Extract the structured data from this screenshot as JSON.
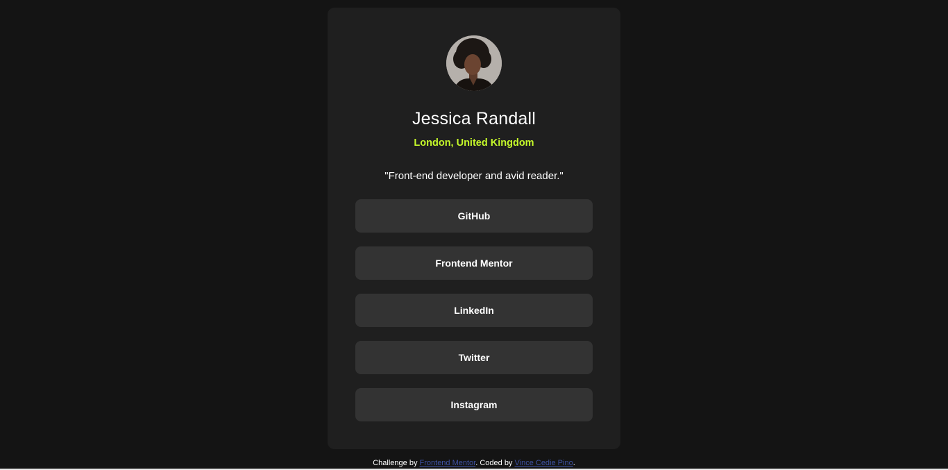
{
  "profile": {
    "name": "Jessica Randall",
    "location": "London, United Kingdom",
    "bio": "\"Front-end developer and avid reader.\""
  },
  "links": [
    {
      "label": "GitHub"
    },
    {
      "label": "Frontend Mentor"
    },
    {
      "label": "LinkedIn"
    },
    {
      "label": "Twitter"
    },
    {
      "label": "Instagram"
    }
  ],
  "footer": {
    "prefix": "Challenge by ",
    "challenge_link": "Frontend Mentor",
    "middle": ". Coded by ",
    "author_link": "Vince Cedie Pino",
    "suffix": "."
  },
  "colors": {
    "background": "#141414",
    "card": "#1f1f1f",
    "button": "#333333",
    "accent": "#c4f82a",
    "link": "#3e52a3"
  }
}
